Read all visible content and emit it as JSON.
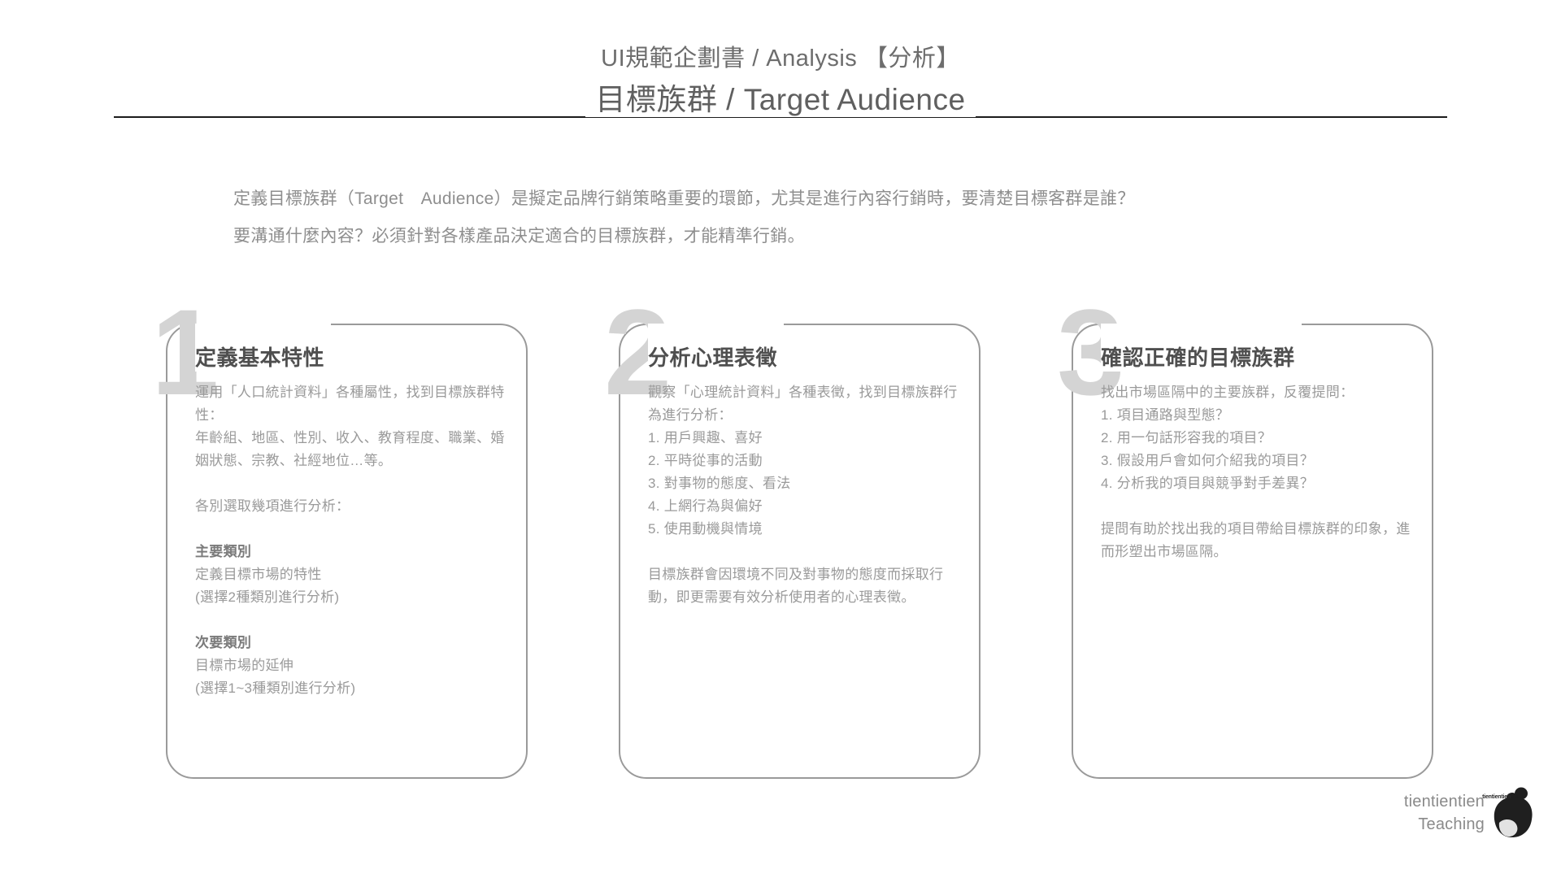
{
  "header": {
    "eyebrow": "UI規範企劃書 / Analysis 【分析】",
    "title": "目標族群 / Target Audience"
  },
  "intro": {
    "line1": "定義目標族群（Target　Audience）是擬定品牌行銷策略重要的環節，尤其是進行內容行銷時，要清楚目標客群是誰？",
    "line2": "要溝通什麼內容？必須針對各樣產品決定適合的目標族群，才能精準行銷。"
  },
  "cards": [
    {
      "number": "1",
      "heading": "定義基本特性",
      "p1": "運用「人口統計資料」各種屬性，找到目標族群特性：",
      "p2": "年齡組、地區、性別、收入、教育程度、職業、婚姻狀態、宗教、社經地位…等。",
      "p3": "各別選取幾項進行分析：",
      "sub1_title": "主要類別",
      "sub1_line1": "定義目標市場的特性",
      "sub1_line2": "(選擇2種類別進行分析)",
      "sub2_title": "次要類別",
      "sub2_line1": "目標市場的延伸",
      "sub2_line2": "(選擇1~3種類別進行分析)"
    },
    {
      "number": "2",
      "heading": "分析心理表徵",
      "p1": "觀察「心理統計資料」各種表徵，找到目標族群行為進行分析：",
      "items": [
        "1.  用戶興趣、喜好",
        "2.  平時從事的活動",
        "3.  對事物的態度、看法",
        "4.  上網行為與偏好",
        "5.  使用動機與情境"
      ],
      "p2": "目標族群會因環境不同及對事物的態度而採取行動，即更需要有效分析使用者的心理表徵。"
    },
    {
      "number": "3",
      "heading": "確認正確的目標族群",
      "p1": "找出市場區隔中的主要族群，反覆提問：",
      "items": [
        "1.  項目通路與型態？",
        "2.  用一句話形容我的項目？",
        "3.  假設用戶會如何介紹我的項目？",
        "4.  分析我的項目與競爭對手差異？"
      ],
      "p2": "提問有助於找出我的項目帶給目標族群的印象，進而形塑出市場區隔。"
    }
  ],
  "logo": {
    "line1": "tientientien",
    "line2": "Teaching",
    "micro": "tientientien"
  },
  "colors": {
    "rule": "#1c1c1c",
    "title_text": "#5f5f5f",
    "body_text": "#9a9a9a",
    "card_border": "#9a9a9a",
    "card_number": "#d4d4d4"
  }
}
